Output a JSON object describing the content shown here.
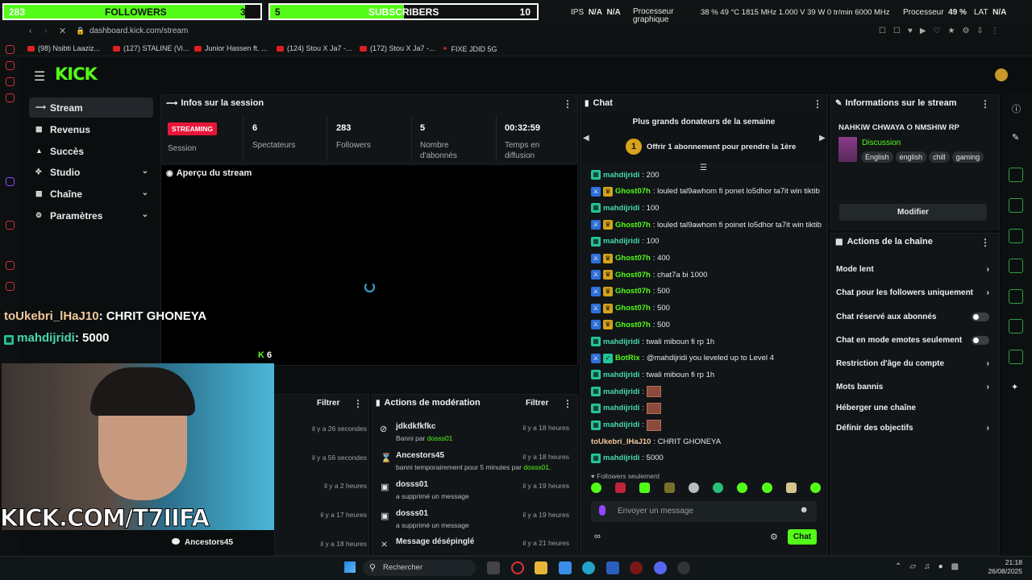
{
  "overlay": {
    "followers": {
      "count": "283",
      "label": "FOLLOWERS",
      "goal": "300",
      "progress": 0.94
    },
    "subs": {
      "count": "5",
      "label": "SUBSCRIBERS",
      "goal": "10",
      "progress": 0.5
    }
  },
  "hwinfo": {
    "ips": "IPS",
    "na1": "N/A",
    "na2": "N/A",
    "gpu_label": "Processeur\ngraphique",
    "gpu_stats": "38 % 49 °C 1815 MHz 1.000 V 39 W 0 tr/min 6000 MHz",
    "cpu_label": "Processeur",
    "cpu_pct": "49 %",
    "lat": "LAT",
    "lat_val": "N/A"
  },
  "browser": {
    "url": "dashboard.kick.com/stream",
    "bookmarks": [
      "(98) Nsibti Laaziz...",
      "(127) STALINE (Vi...",
      "Junior Hassen ft. ...",
      "(124) Stou X Ja7 -...",
      "(172) Stou X Ja7 -...",
      "FIXE JDID 5G"
    ]
  },
  "logo": "KICK",
  "sidebar": {
    "items": [
      {
        "label": "Stream",
        "icon": "stream-icon"
      },
      {
        "label": "Revenus",
        "icon": "revenue-icon"
      },
      {
        "label": "Succès",
        "icon": "trophy-icon"
      },
      {
        "label": "Studio",
        "icon": "studio-icon"
      },
      {
        "label": "Chaîne",
        "icon": "channel-icon"
      },
      {
        "label": "Paramètres",
        "icon": "settings-icon"
      }
    ]
  },
  "session": {
    "title": "Infos sur la session",
    "status": "STREAMING",
    "status_label": "Session",
    "stats": [
      {
        "value": "6",
        "label": "Spectateurs"
      },
      {
        "value": "283",
        "label": "Followers"
      },
      {
        "value": "5",
        "label": "Nombre d'abonnés"
      },
      {
        "value": "00:32:59",
        "label": "Temps en diffusion"
      }
    ]
  },
  "preview": {
    "title": "Aperçu du stream",
    "viewers": "6"
  },
  "overlay_chat": [
    {
      "user": "toUkebri_lHaJ10",
      "text": ": CHRIT GHONEYA"
    },
    {
      "user": "mahdijridi",
      "text": ": 5000"
    }
  ],
  "webcam_text": "KICK.COM/T7IIFA",
  "stream_feed": {
    "filter": "Filtrer",
    "times": [
      "il y a 26 secondes",
      "il y a 56 secondes",
      "il y a 2 heures",
      "il y a 17 heures",
      "il y a 18 heures"
    ],
    "last_user": "Ancestors45"
  },
  "moderation": {
    "title": "Actions de modération",
    "filter": "Filtrer",
    "rows": [
      {
        "user": "jdkdkfkfkc",
        "desc": "Banni par ",
        "by": "dosss01",
        "time": "il y a 18 heures",
        "icon": "ban-icon"
      },
      {
        "user": "Ancestors45",
        "desc": "banni temporairement pour 5 minutes par ",
        "by": "dosss01.",
        "time": "il y a 18 heures",
        "icon": "timer-icon"
      },
      {
        "user": "dosss01",
        "desc": "a supprimé un message",
        "by": "",
        "time": "il y a 19 heures",
        "icon": "trash-icon"
      },
      {
        "user": "dosss01",
        "desc": "a supprimé un message",
        "by": "",
        "time": "il y a 19 heures",
        "icon": "trash-icon"
      },
      {
        "user": "Message désépinglé",
        "desc": "",
        "by": "",
        "time": "il y a 21 heures",
        "icon": "unpin-icon"
      }
    ]
  },
  "chat": {
    "title": "Chat",
    "donors_title": "Plus grands donateurs de la semaine",
    "donor_cta": "Offrir 1 abonnement pour prendre la 1ère",
    "messages": [
      {
        "user": "mahdijridi",
        "text": ": 200",
        "badges": "v",
        "color": "#49d8b0"
      },
      {
        "user": "Ghost07h",
        "text": ": louled tal9awhom fi ponet lo5dhor ta7it win tiktib",
        "badges": "a",
        "color": "#53fc18"
      },
      {
        "user": "mahdijridi",
        "text": ": 100",
        "badges": "v",
        "color": "#49d8b0"
      },
      {
        "user": "Ghost07h",
        "text": ": louled tal9awhom fi poinet lo5dhor ta7it win tiktib",
        "badges": "a",
        "color": "#53fc18"
      },
      {
        "user": "mahdijridi",
        "text": ": 100",
        "badges": "v",
        "color": "#49d8b0"
      },
      {
        "user": "Ghost07h",
        "text": ": 400",
        "badges": "a",
        "color": "#53fc18"
      },
      {
        "user": "Ghost07h",
        "text": ": chat7a bi 1000",
        "badges": "a",
        "color": "#53fc18"
      },
      {
        "user": "Ghost07h",
        "text": ": 500",
        "badges": "a",
        "color": "#53fc18"
      },
      {
        "user": "Ghost07h",
        "text": ": 500",
        "badges": "a",
        "color": "#53fc18"
      },
      {
        "user": "Ghost07h",
        "text": ": 500",
        "badges": "a",
        "color": "#53fc18"
      },
      {
        "user": "mahdijridi",
        "text": ": twali miboun fi rp 1h",
        "badges": "v",
        "color": "#49d8b0"
      },
      {
        "user": "BotRix",
        "text": ": @mahdijridi you leveled up to Level 4",
        "badges": "b",
        "color": "#53fc18"
      },
      {
        "user": "mahdijridi",
        "text": ": twali miboun fi rp 1h",
        "badges": "v",
        "color": "#49d8b0"
      },
      {
        "user": "mahdijridi",
        "text": ":",
        "badges": "v",
        "color": "#49d8b0",
        "emote": true
      },
      {
        "user": "mahdijridi",
        "text": ":",
        "badges": "v",
        "color": "#49d8b0",
        "emote": true
      },
      {
        "user": "mahdijridi",
        "text": ":",
        "badges": "v",
        "color": "#49d8b0",
        "emote": true
      },
      {
        "user": "toUkebri_lHaJ10",
        "text": ": CHRIT GHONEYA",
        "badges": "",
        "color": "#f3c89b"
      },
      {
        "user": "mahdijridi",
        "text": ": 5000",
        "badges": "v",
        "color": "#49d8b0"
      }
    ],
    "followers_only": "Followers seulement",
    "input_placeholder": "Envoyer un message",
    "send": "Chat"
  },
  "stream_info": {
    "title": "Informations sur le stream",
    "stream_title": "NAHKIW CHWAYA O NMSHIW RP",
    "category": "Discussion",
    "tags": [
      "English",
      "english",
      "chill",
      "gaming"
    ],
    "edit": "Modifier"
  },
  "channel_actions": {
    "title": "Actions de la chaîne",
    "items": [
      {
        "label": "Mode lent",
        "type": "chevron"
      },
      {
        "label": "Chat pour les followers uniquement",
        "type": "chevron"
      },
      {
        "label": "Chat réservé aux abonnés",
        "type": "toggle"
      },
      {
        "label": "Chat en mode emotes seulement",
        "type": "toggle"
      },
      {
        "label": "Restriction d'âge du compte",
        "type": "chevron"
      },
      {
        "label": "Mots bannis",
        "type": "chevron"
      },
      {
        "label": "Héberger une chaîne",
        "type": "none"
      },
      {
        "label": "Définir des objectifs",
        "type": "chevron"
      }
    ]
  },
  "taskbar": {
    "search": "Rechercher",
    "time": "21:18",
    "date": "26/08/2025"
  },
  "colors": {
    "kick_green": "#53fc18",
    "streaming_red": "#e8173a"
  }
}
